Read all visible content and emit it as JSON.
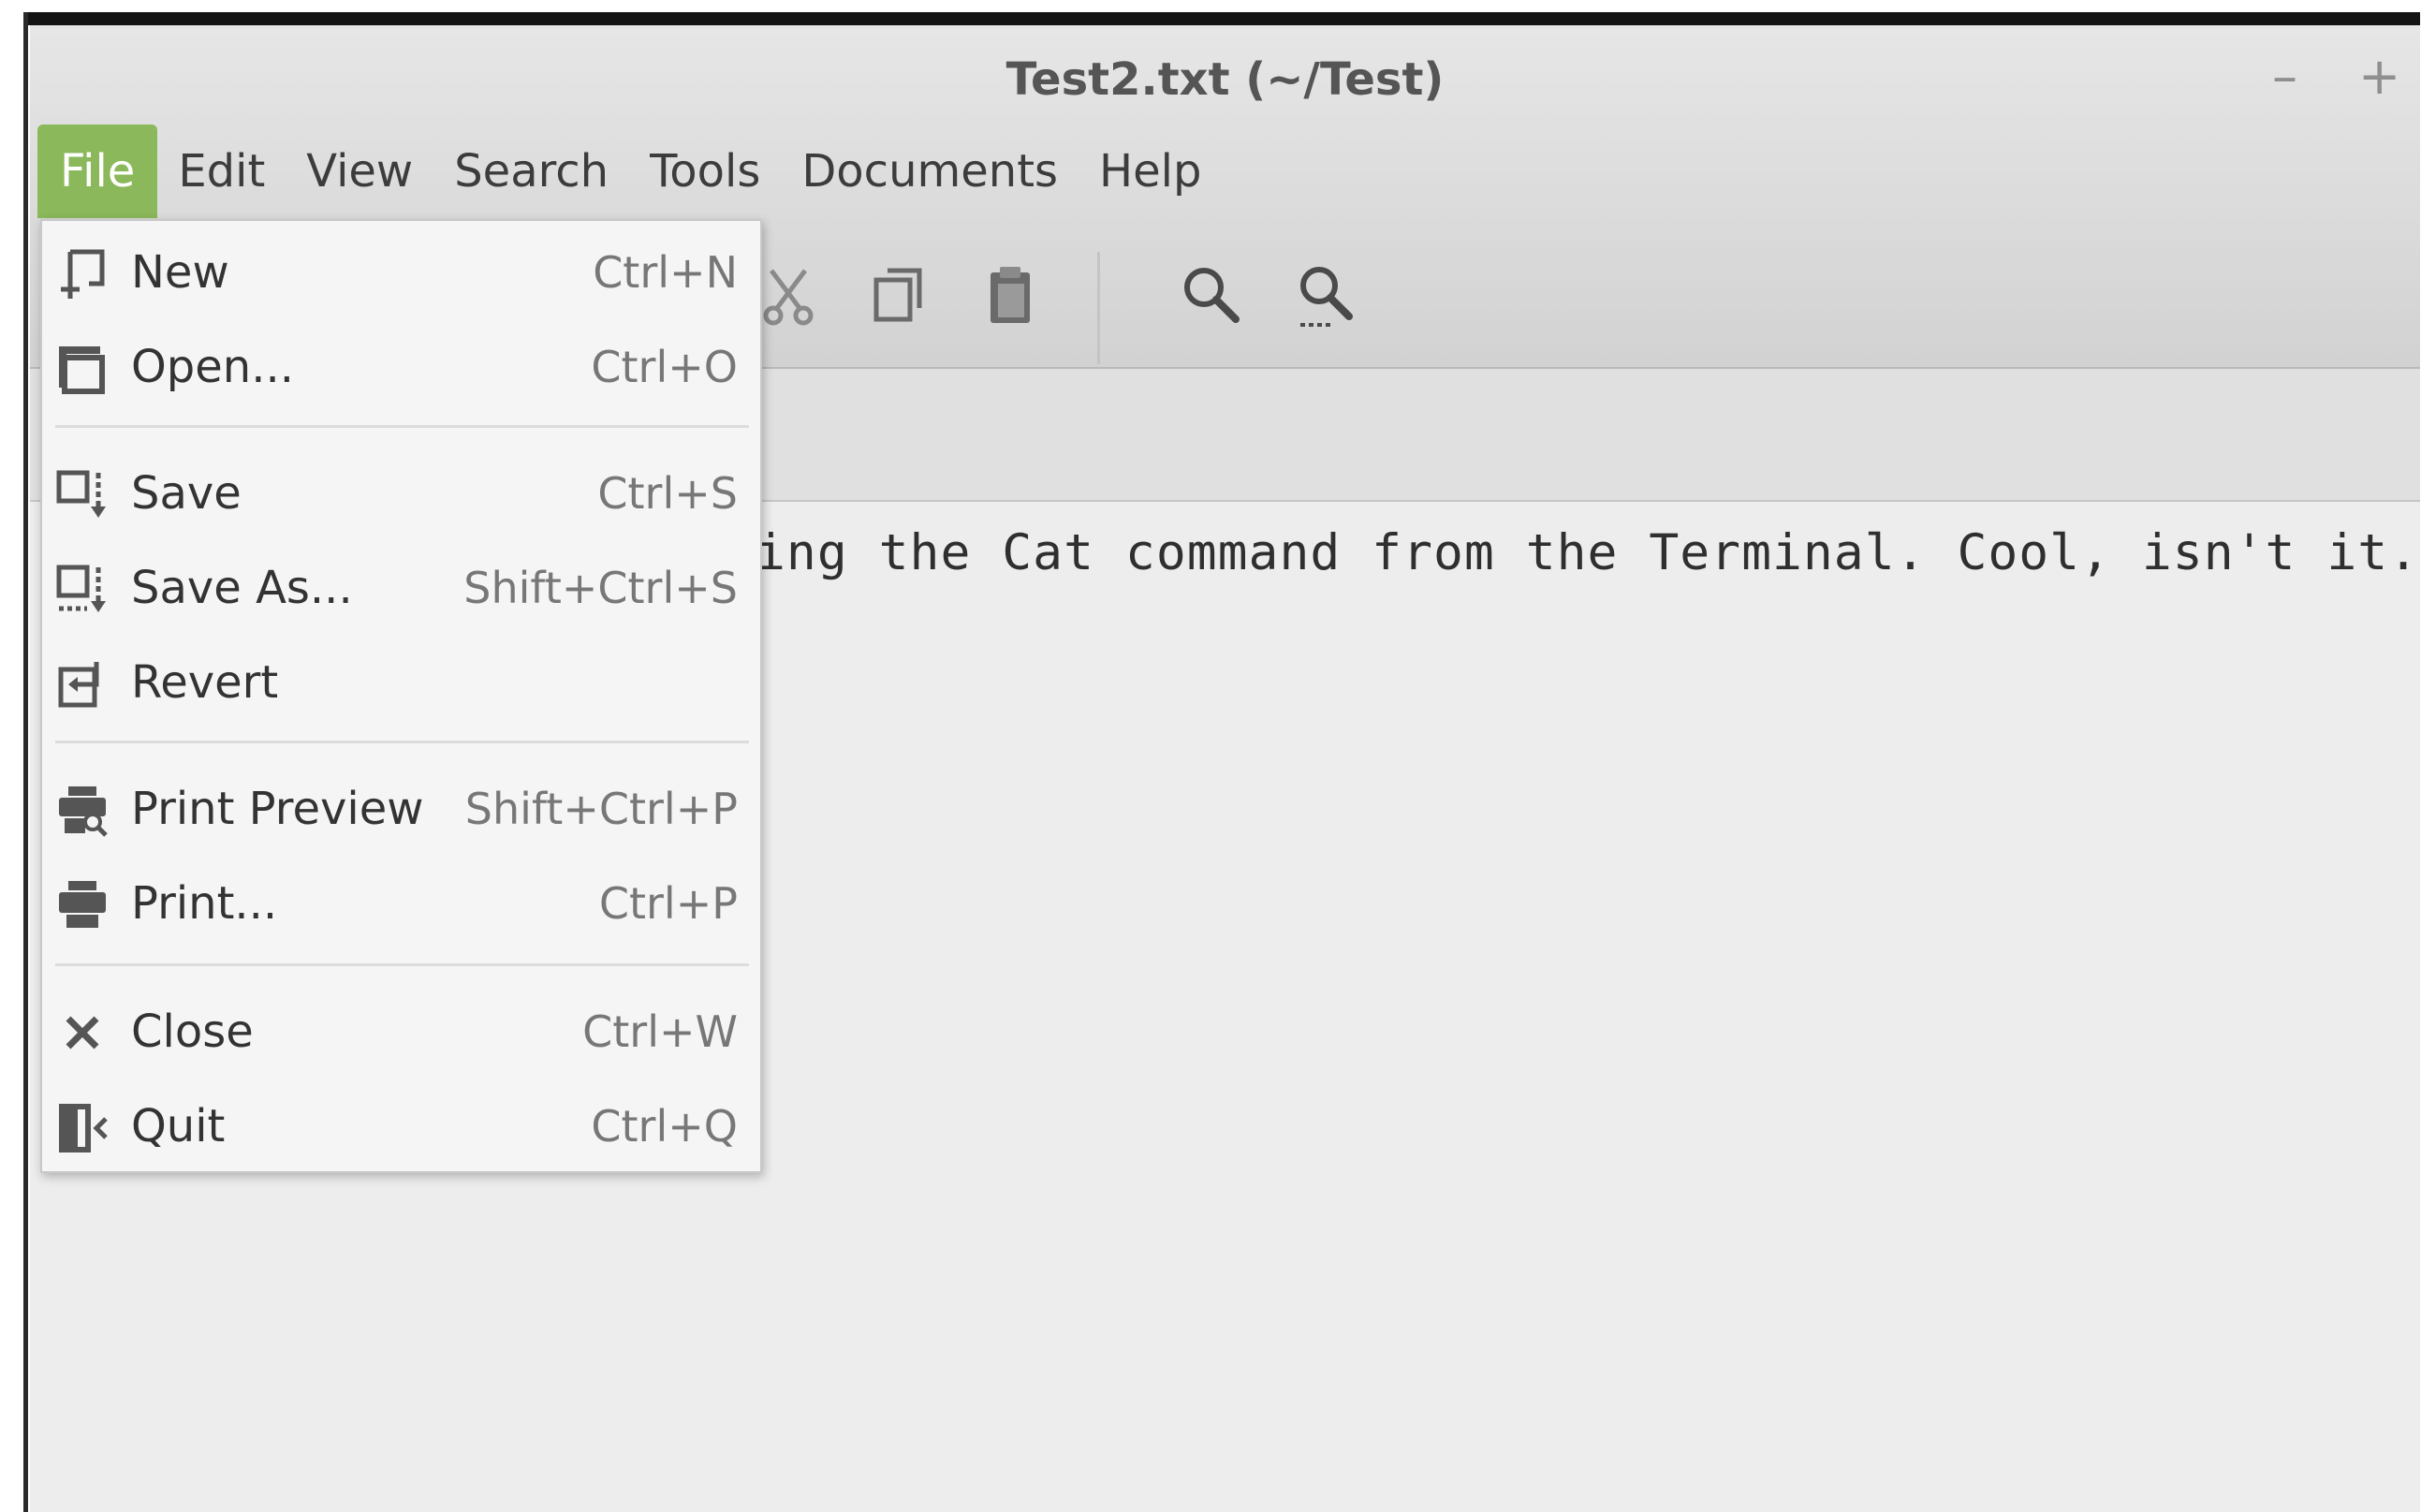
{
  "window": {
    "title": "Test2.txt (~/Test)",
    "minimize_glyph": "–",
    "maximize_glyph": "+"
  },
  "menubar": {
    "items": [
      "File",
      "Edit",
      "View",
      "Search",
      "Tools",
      "Documents",
      "Help"
    ],
    "active": "File"
  },
  "toolbar": {
    "icons": [
      "cut-icon",
      "copy-icon",
      "paste-icon",
      "find-icon",
      "replace-icon"
    ]
  },
  "editor": {
    "visible_text": "ing the Cat command from the Terminal. Cool, isn't it."
  },
  "file_menu": {
    "items": [
      {
        "label": "New",
        "accel": "Ctrl+N",
        "icon": "new-document-icon"
      },
      {
        "label": "Open...",
        "accel": "Ctrl+O",
        "icon": "open-icon"
      },
      {
        "label": "Save",
        "accel": "Ctrl+S",
        "icon": "save-icon"
      },
      {
        "label": "Save As...",
        "accel": "Shift+Ctrl+S",
        "icon": "save-as-icon"
      },
      {
        "label": "Revert",
        "accel": "",
        "icon": "revert-icon"
      },
      {
        "label": "Print Preview",
        "accel": "Shift+Ctrl+P",
        "icon": "print-preview-icon"
      },
      {
        "label": "Print...",
        "accel": "Ctrl+P",
        "icon": "print-icon"
      },
      {
        "label": "Close",
        "accel": "Ctrl+W",
        "icon": "close-icon"
      },
      {
        "label": "Quit",
        "accel": "Ctrl+Q",
        "icon": "quit-icon"
      }
    ]
  },
  "colors": {
    "menu_active": "#8bb85a",
    "icon": "#5a5a5a"
  }
}
